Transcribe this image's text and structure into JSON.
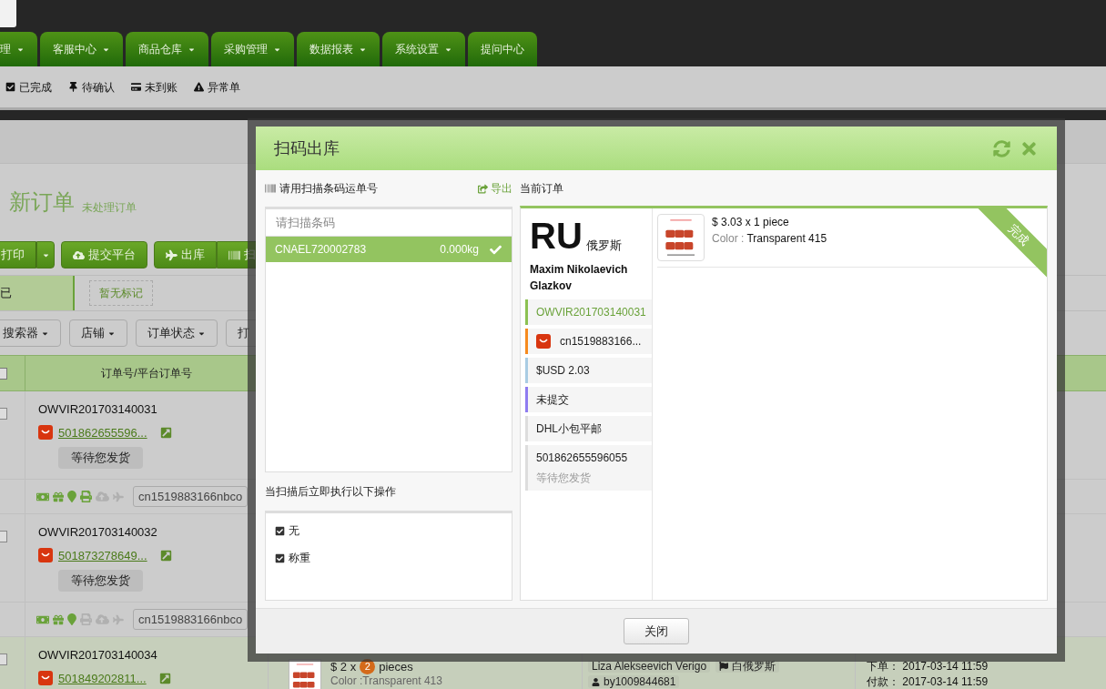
{
  "nav": {
    "tabs": [
      {
        "label": "理",
        "dropdown": true
      },
      {
        "label": "客服中心",
        "dropdown": true
      },
      {
        "label": "商品仓库",
        "dropdown": true
      },
      {
        "label": "采购管理",
        "dropdown": true
      },
      {
        "label": "数据报表",
        "dropdown": true
      },
      {
        "label": "系统设置",
        "dropdown": true
      },
      {
        "label": "提问中心",
        "dropdown": false
      }
    ]
  },
  "subnav": [
    {
      "label": "已完成"
    },
    {
      "label": "待确认"
    },
    {
      "label": "未到账"
    },
    {
      "label": "异常单"
    }
  ],
  "page": {
    "title": "新订单",
    "subtitle": "未处理订单"
  },
  "actions": [
    [
      {
        "label": "打印",
        "dropdown": true
      }
    ],
    [
      {
        "label": "提交平台",
        "dropdown": false
      }
    ],
    [
      {
        "label": "出库",
        "dropdown": false
      },
      {
        "label": "扫",
        "dropdown": false
      }
    ]
  ],
  "marks": {
    "current": "已",
    "empty": "暂无标记"
  },
  "filters": [
    "搜索器",
    "店铺",
    "订单状态",
    "打"
  ],
  "table": {
    "all_selected": false,
    "columns": [
      "订单号/平台订单号"
    ],
    "rows": [
      {
        "order_id": "OWVIR201703140031",
        "platform_id": "501862655596...",
        "status": "等待您发货",
        "tracking": "cn1519883166nbco",
        "printed": true,
        "selected": false
      },
      {
        "order_id": "OWVIR201703140032",
        "platform_id": "501873278649...",
        "status": "等待您发货",
        "tracking": "cn1519883166nbco",
        "printed": false,
        "selected": false
      },
      {
        "order_id": "OWVIR201703140034",
        "platform_id": "501849202811...",
        "selected": true,
        "product": {
          "price": "$ 2 x",
          "qty": "2",
          "unit": "pieces",
          "variant": "Color :Transparent 413"
        },
        "customer": "Liza Alekseevich Verigo",
        "country": "白俄罗斯",
        "buyer": "by1009844681",
        "dates": [
          {
            "label": "下单：",
            "value": "2017-03-14 11:59"
          },
          {
            "label": "付款：",
            "value": "2017-03-14 11:59"
          }
        ]
      }
    ]
  },
  "modal": {
    "title": "扫码出库",
    "scan": {
      "label": "请用扫描条码运单号",
      "export": "导出",
      "placeholder": "请扫描条码",
      "items": [
        {
          "code": "CNAEL720002783",
          "weight": "0.000kg",
          "done": true
        }
      ]
    },
    "after_scan": {
      "label": "当扫描后立即执行以下操作",
      "options": [
        {
          "label": "无",
          "checked": true
        },
        {
          "label": "称重",
          "checked": true
        }
      ]
    },
    "current": {
      "label": "当前订单",
      "country_code": "RU",
      "country": "俄罗斯",
      "name": "Maxim Nikolaevich Glazkov",
      "fields": [
        {
          "kind": "order",
          "text": "OWVIR201703140031",
          "color": "#8cc152"
        },
        {
          "kind": "platform",
          "text": "cn1519883166...",
          "color": "#f68a1e"
        },
        {
          "kind": "plain",
          "text": "$USD 2.03",
          "color": "#a9cce3"
        },
        {
          "kind": "plain",
          "text": "未提交",
          "color": "#8e7cf0"
        },
        {
          "kind": "plain",
          "text": "DHL小包平邮",
          "color": "#dddddd"
        },
        {
          "kind": "tracking",
          "text": "501862655596055",
          "sub": "等待您发货",
          "color": "#dddddd"
        }
      ],
      "products": [
        {
          "price": "$ 3.03 x 1 piece",
          "color_label": "Color :",
          "color_value": "Transparent 415"
        }
      ],
      "ribbon": "完成"
    },
    "close": "关闭"
  }
}
